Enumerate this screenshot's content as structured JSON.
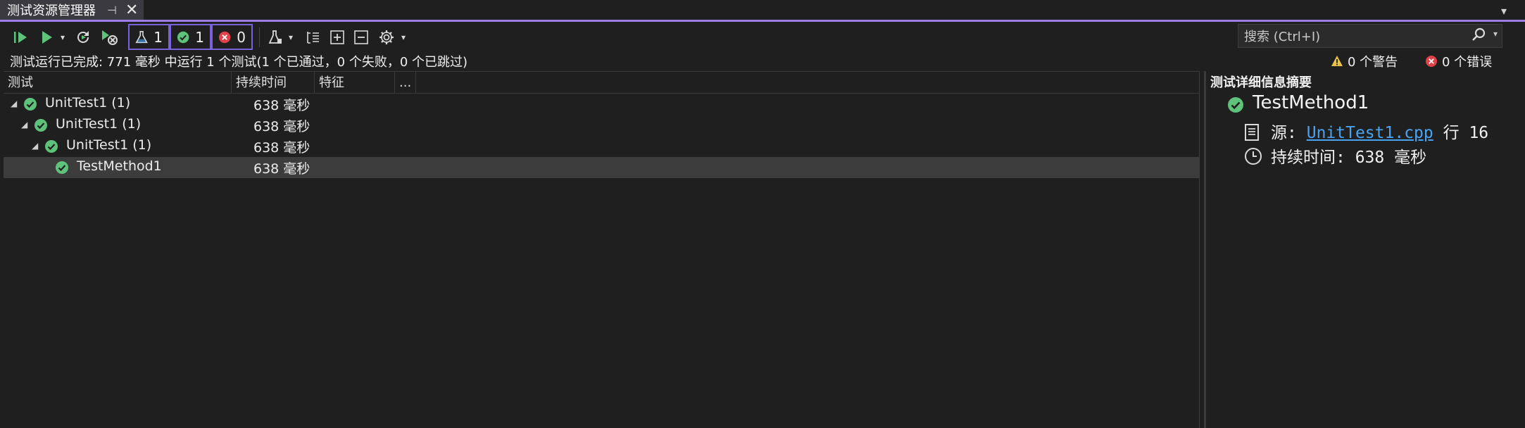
{
  "window": {
    "tab_title": "测试资源管理器",
    "pin_icon": "pin-icon",
    "close_icon": "close-icon"
  },
  "toolbar": {
    "run_all_icon": "run-all-icon",
    "run_icon": "run-icon",
    "rerun_failed_icon": "rerun-icon",
    "cancel_icon": "cancel-run-icon",
    "total_count": "1",
    "passed_count": "1",
    "failed_count": "0",
    "playlist_icon": "playlist-icon",
    "group_icon": "group-by-icon",
    "expand_icon": "expand-all-icon",
    "collapse_icon": "collapse-all-icon",
    "settings_icon": "gear-icon",
    "search_placeholder": "搜索 (Ctrl+I)"
  },
  "status": {
    "summary": "测试运行已完成: 771 毫秒 中运行 1 个测试(1 个已通过，0 个失败，0 个已跳过)",
    "warnings": "0 个警告",
    "errors": "0 个错误"
  },
  "grid": {
    "columns": [
      "测试",
      "持续时间",
      "特征",
      "..."
    ],
    "rows": [
      {
        "name": "UnitTest1 (1)",
        "duration": "638 毫秒",
        "level": 0
      },
      {
        "name": "UnitTest1 (1)",
        "duration": "638 毫秒",
        "level": 1
      },
      {
        "name": "UnitTest1 (1)",
        "duration": "638 毫秒",
        "level": 2
      },
      {
        "name": "TestMethod1",
        "duration": "638 毫秒",
        "level": 3
      }
    ]
  },
  "details": {
    "title": "测试详细信息摘要",
    "method": "TestMethod1",
    "source_label": "源:",
    "source_file": "UnitTest1.cpp",
    "line_label": "行 16",
    "duration_label": "持续时间: 638 毫秒"
  },
  "colors": {
    "accent": "#9b7fe6",
    "pass": "#5fc27a",
    "fail": "#e0424a",
    "warn": "#e8c34a",
    "link": "#4aa3f0"
  }
}
